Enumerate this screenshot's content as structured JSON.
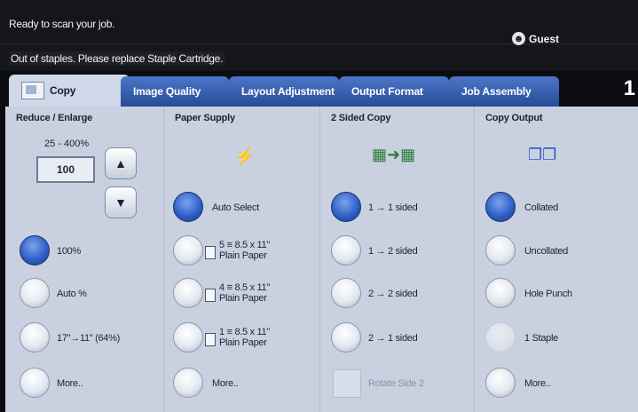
{
  "status": {
    "line1": "Ready to scan your job.",
    "line2": "Out of staples. Please replace Staple Cartridge.",
    "user": "Guest"
  },
  "tabs": [
    {
      "label": "Copy",
      "active": true
    },
    {
      "label": "Image Quality"
    },
    {
      "label": "Layout Adjustment"
    },
    {
      "label": "Output Format"
    },
    {
      "label": "Job Assembly"
    }
  ],
  "tab_counter": "1",
  "reduce_enlarge": {
    "title": "Reduce / Enlarge",
    "range": "25 - 400%",
    "value": "100",
    "options": [
      "100%",
      "Auto %",
      "17\"→11\" (64%)",
      "More.."
    ]
  },
  "paper_supply": {
    "title": "Paper Supply",
    "options": [
      {
        "line1": "Auto Select"
      },
      {
        "line1": "5 ≡ 8.5 x 11\"",
        "line2": "Plain Paper"
      },
      {
        "line1": "4 ≡ 8.5 x 11\"",
        "line2": "Plain Paper"
      },
      {
        "line1": "1 ≡ 8.5 x 11\"",
        "line2": "Plain Paper"
      },
      {
        "line1": "More.."
      }
    ]
  },
  "two_sided": {
    "title": "2 Sided Copy",
    "options": [
      "1 → 1 sided",
      "1 → 2 sided",
      "2 → 2 sided",
      "2 → 1 sided"
    ],
    "rotate_label": "Rotate Side 2"
  },
  "copy_output": {
    "title": "Copy Output",
    "options": [
      "Collated",
      "Uncollated",
      "Hole Punch",
      "1 Staple",
      "More.."
    ]
  },
  "colors": {
    "tab_blue": "#3b63b5",
    "panel_bg": "#c9d1e1",
    "radio_on": "#2b5bc3"
  }
}
